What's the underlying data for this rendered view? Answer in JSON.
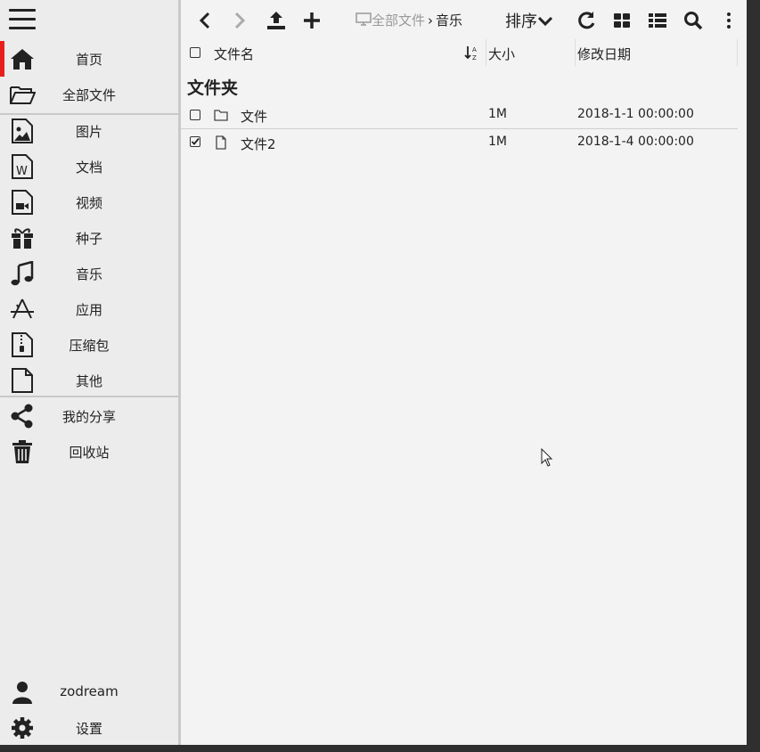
{
  "sidebar": {
    "items": [
      {
        "label": "首页",
        "icon": "home-icon",
        "active": true
      },
      {
        "label": "全部文件",
        "icon": "folder-open-icon"
      },
      {
        "label": "图片",
        "icon": "image-file-icon"
      },
      {
        "label": "文档",
        "icon": "word-file-icon"
      },
      {
        "label": "视频",
        "icon": "video-file-icon"
      },
      {
        "label": "种子",
        "icon": "gift-icon"
      },
      {
        "label": "音乐",
        "icon": "music-icon"
      },
      {
        "label": "应用",
        "icon": "app-icon"
      },
      {
        "label": "压缩包",
        "icon": "zip-file-icon"
      },
      {
        "label": "其他",
        "icon": "file-icon"
      },
      {
        "label": "我的分享",
        "icon": "share-icon"
      },
      {
        "label": "回收站",
        "icon": "trash-icon"
      }
    ],
    "user": {
      "label": "zodream",
      "icon": "user-icon"
    },
    "settings": {
      "label": "设置",
      "icon": "gear-icon"
    }
  },
  "toolbar": {
    "breadcrumb_root": "全部文件",
    "breadcrumb_current": "音乐",
    "sort_label": "排序"
  },
  "table": {
    "col_name": "文件名",
    "col_size": "大小",
    "col_date": "修改日期",
    "section_title": "文件夹",
    "rows": [
      {
        "name": "文件",
        "size": "1M",
        "date": "2018-1-1 00:00:00",
        "type": "folder",
        "checked": false
      },
      {
        "name": "文件2",
        "size": "1M",
        "date": "2018-1-4 00:00:00",
        "type": "file",
        "checked": true
      }
    ]
  },
  "colors": {
    "accent": "#e8201c",
    "sidebar_bg": "#ececec",
    "main_bg": "#f3f3f3"
  }
}
